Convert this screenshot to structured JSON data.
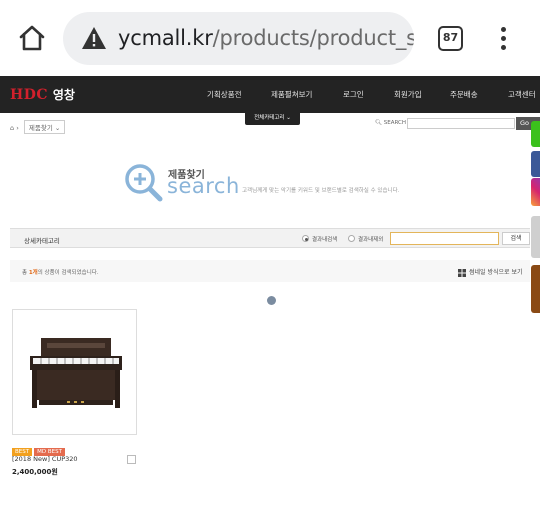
{
  "browser": {
    "url_host": "ycmall.kr",
    "url_path": "/products/product_se",
    "tab_count": "87"
  },
  "site": {
    "logo_brand": "HDC",
    "logo_suffix": "영창",
    "nav": [
      "기획상품전",
      "제품펼쳐보기",
      "로그인",
      "회원가입",
      "주문배송",
      "고객센터"
    ],
    "all_categories_label": "전체카테고리",
    "breadcrumb_select": "제품찾기",
    "top_search_label": "SEARCH",
    "top_search_button": "Go"
  },
  "search_banner": {
    "title_kr": "제품찾기",
    "title_en": "search",
    "description": "고객님께게 맞는 악기를 키워드 및 브랜드별로 검색하실 수 있습니다."
  },
  "detail_search": {
    "title": "상세카테고리",
    "option_in_result": "결과내검색",
    "option_exclude": "결과내제외",
    "input_value": "",
    "button": "검색"
  },
  "results": {
    "prefix": "총 ",
    "count": "1개",
    "suffix": "의 상품이 검색되었습니다.",
    "view_toggle": "썸네일 방식으로 보기"
  },
  "products": [
    {
      "badges": [
        "BEST",
        "MD BEST"
      ],
      "name": "[2018 New] CUP320",
      "price": "2,400,000원"
    }
  ]
}
